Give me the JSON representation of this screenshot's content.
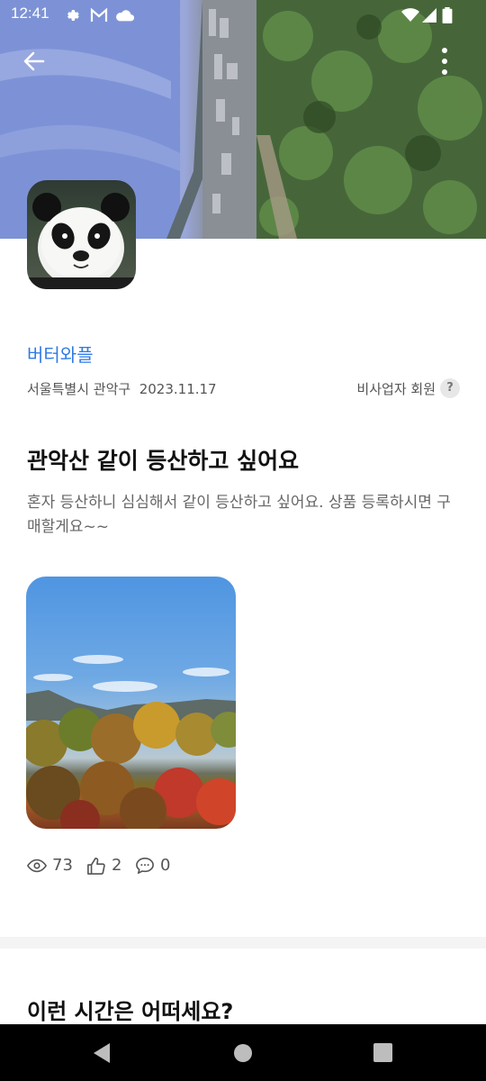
{
  "status_bar": {
    "time": "12:41"
  },
  "header": {
    "back_icon": "arrow-left-icon",
    "more_icon": "more-vertical-icon"
  },
  "profile": {
    "nickname": "버터와플",
    "location": "서울특별시 관악구",
    "date": "2023.11.17",
    "member_type": "비사업자 회원",
    "help_label": "?"
  },
  "post": {
    "title": "관악산 같이 등산하고 싶어요",
    "body": "혼자 등산하니 심심해서 같이 등산하고 싶어요. 상품 등록하시면 구매할게요~~"
  },
  "stats": {
    "views": "73",
    "likes": "2",
    "comments": "0"
  },
  "recommend": {
    "title": "이런 시간은 어떠세요?"
  },
  "colors": {
    "accent": "#2f7ae5",
    "navbar": "#000000"
  }
}
